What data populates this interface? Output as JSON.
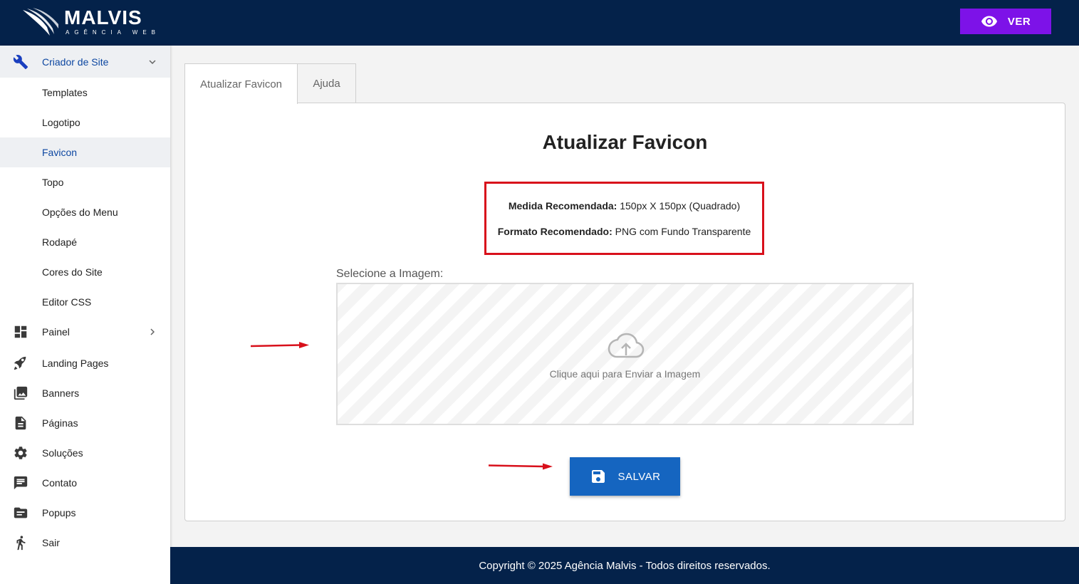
{
  "header": {
    "logo_name": "MALVIS",
    "logo_sub": "AGÊNCIA WEB",
    "view_button": "VER"
  },
  "sidebar": {
    "site_builder": {
      "label": "Criador de Site",
      "icon": "wrench-icon",
      "subitems": [
        {
          "label": "Templates"
        },
        {
          "label": "Logotipo"
        },
        {
          "label": "Favicon",
          "active": true
        },
        {
          "label": "Topo"
        },
        {
          "label": "Opções do Menu"
        },
        {
          "label": "Rodapé"
        },
        {
          "label": "Cores do Site"
        },
        {
          "label": "Editor CSS"
        }
      ]
    },
    "items": [
      {
        "label": "Painel",
        "icon": "dashboard-icon"
      },
      {
        "label": "Landing Pages",
        "icon": "rocket-icon"
      },
      {
        "label": "Banners",
        "icon": "photo-library-icon"
      },
      {
        "label": "Páginas",
        "icon": "document-icon"
      },
      {
        "label": "Soluções",
        "icon": "gear-icon"
      },
      {
        "label": "Contato",
        "icon": "chat-icon"
      },
      {
        "label": "Popups",
        "icon": "popup-icon"
      },
      {
        "label": "Sair",
        "icon": "exit-person-icon"
      }
    ]
  },
  "tabs": [
    {
      "label": "Atualizar Favicon",
      "active": true
    },
    {
      "label": "Ajuda"
    }
  ],
  "main": {
    "title": "Atualizar Favicon",
    "recommendation": {
      "size_label": "Medida Recomendada:",
      "size_value": "150px X 150px (Quadrado)",
      "format_label": "Formato Recomendado:",
      "format_value": "PNG com Fundo Transparente"
    },
    "select_label": "Selecione a Imagem:",
    "dropzone_text": "Clique aqui para Enviar a Imagem",
    "save_button": "SALVAR"
  },
  "footer": {
    "copyright": "Copyright © 2025 Agência Malvis - Todos direitos reservados."
  },
  "colors": {
    "header_bg": "#04224a",
    "view_button": "#7d12e8",
    "save_button": "#1565c0",
    "highlight_border": "#d8101b"
  }
}
